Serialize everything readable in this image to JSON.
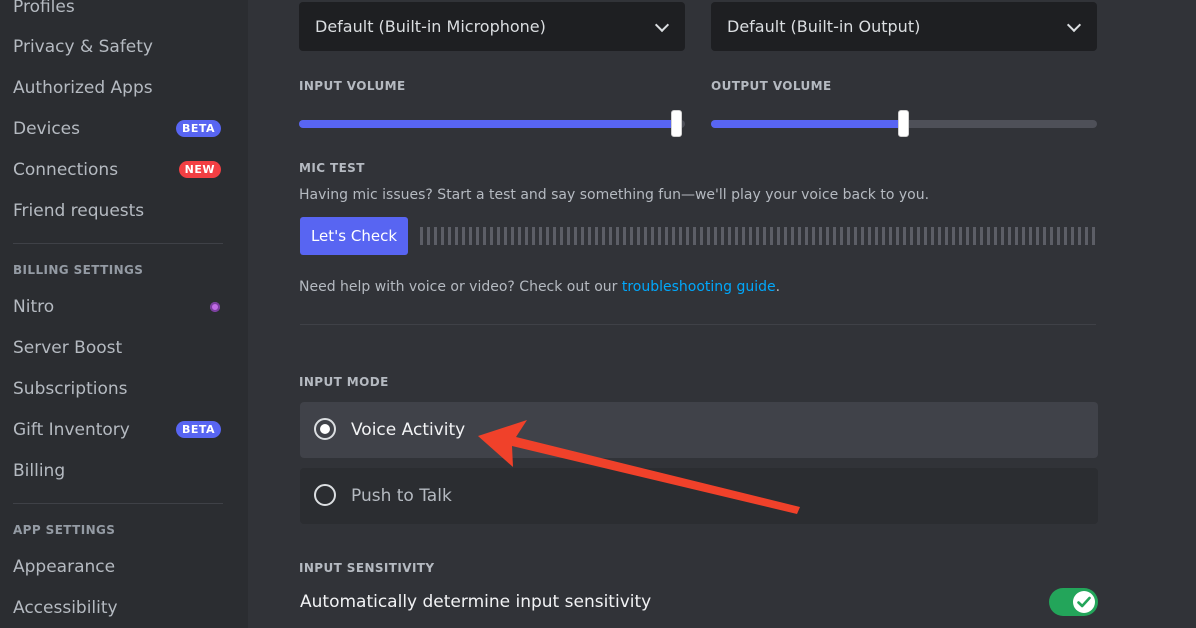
{
  "sidebar": {
    "items_top": [
      {
        "label": "Profiles"
      },
      {
        "label": "Privacy & Safety"
      },
      {
        "label": "Authorized Apps"
      },
      {
        "label": "Devices",
        "badge": "BETA"
      },
      {
        "label": "Connections",
        "badge": "NEW"
      },
      {
        "label": "Friend requests"
      }
    ],
    "billing_header": "BILLING SETTINGS",
    "billing_items": [
      {
        "label": "Nitro"
      },
      {
        "label": "Server Boost"
      },
      {
        "label": "Subscriptions"
      },
      {
        "label": "Gift Inventory",
        "badge": "BETA"
      },
      {
        "label": "Billing"
      }
    ],
    "app_header": "APP SETTINGS",
    "app_items": [
      {
        "label": "Appearance"
      },
      {
        "label": "Accessibility"
      }
    ]
  },
  "devices": {
    "input_device": "Default (Built-in Microphone)",
    "output_device": "Default (Built-in Output)"
  },
  "volume": {
    "input_label": "INPUT VOLUME",
    "output_label": "OUTPUT VOLUME",
    "input_level": 0.98,
    "output_level": 0.5
  },
  "mic_test": {
    "label": "MIC TEST",
    "description": "Having mic issues? Start a test and say something fun—we'll play your voice back to you.",
    "button": "Let's Check",
    "help_prefix": "Need help with voice or video? Check out our ",
    "help_link": "troubleshooting guide",
    "help_suffix": "."
  },
  "input_mode": {
    "label": "INPUT MODE",
    "options": [
      {
        "label": "Voice Activity",
        "selected": true
      },
      {
        "label": "Push to Talk",
        "selected": false
      }
    ]
  },
  "sensitivity": {
    "label": "INPUT SENSITIVITY",
    "auto_label": "Automatically determine input sensitivity",
    "auto_enabled": true
  },
  "colors": {
    "accent": "#5865f2",
    "toggle_on": "#23a55a",
    "link": "#00a8fc",
    "annotation_arrow": "#f0412a"
  }
}
